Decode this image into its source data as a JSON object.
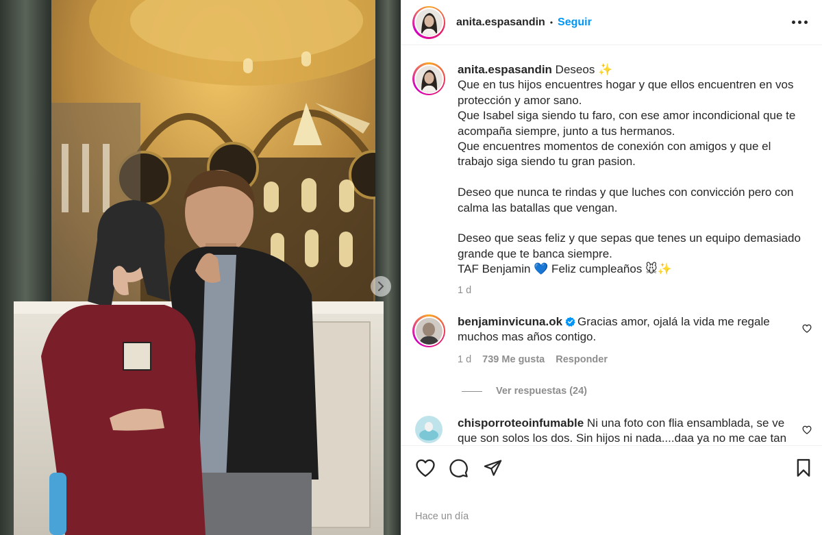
{
  "post": {
    "username": "anita.espasandin",
    "follow_label": "Seguir",
    "separator": "•",
    "timestamp": "Hace un día"
  },
  "caption": {
    "username": "anita.espasandin",
    "lines": [
      "Deseos ✨",
      "Que en tus hijos encuentres hogar y que ellos encuentren en vos protección y amor sano.",
      "Que Isabel siga siendo tu faro, con ese amor incondicional que te acompaña siempre, junto a tus hermanos.",
      "Que encuentres momentos de conexión con amigos y que el trabajo siga siendo tu gran pasion.",
      "",
      "Deseo que nunca te rindas y que luches con convicción pero con calma las batallas que vengan.",
      "",
      "Deseo que seas feliz y que sepas que tenes un equipo demasiado grande que te banca siempre.",
      "TAF Benjamin 💙 Feliz cumpleaños 🐭✨"
    ],
    "age": "1 d"
  },
  "comments": [
    {
      "username": "benjaminvicuna.ok",
      "verified": true,
      "text": "Gracias amor, ojalá la vida me regale muchos mas años contigo.",
      "age": "1 d",
      "likes": "739 Me gusta",
      "reply_label": "Responder",
      "view_replies": "Ver respuestas (24)"
    },
    {
      "username": "chisporroteoinfumable",
      "verified": false,
      "text": "Ni una foto con flia ensamblada, se ve que son solos los dos. Sin hijos ni nada....daa ya no me cae tan"
    }
  ],
  "colors": {
    "accent": "#0095f6",
    "text": "#262626",
    "muted": "#8e8e8e",
    "verified": "#0095f6"
  },
  "icons": [
    "heart-icon",
    "comment-icon",
    "share-icon",
    "bookmark-icon",
    "more-options-icon",
    "verified-badge-icon",
    "chevron-right-icon"
  ]
}
